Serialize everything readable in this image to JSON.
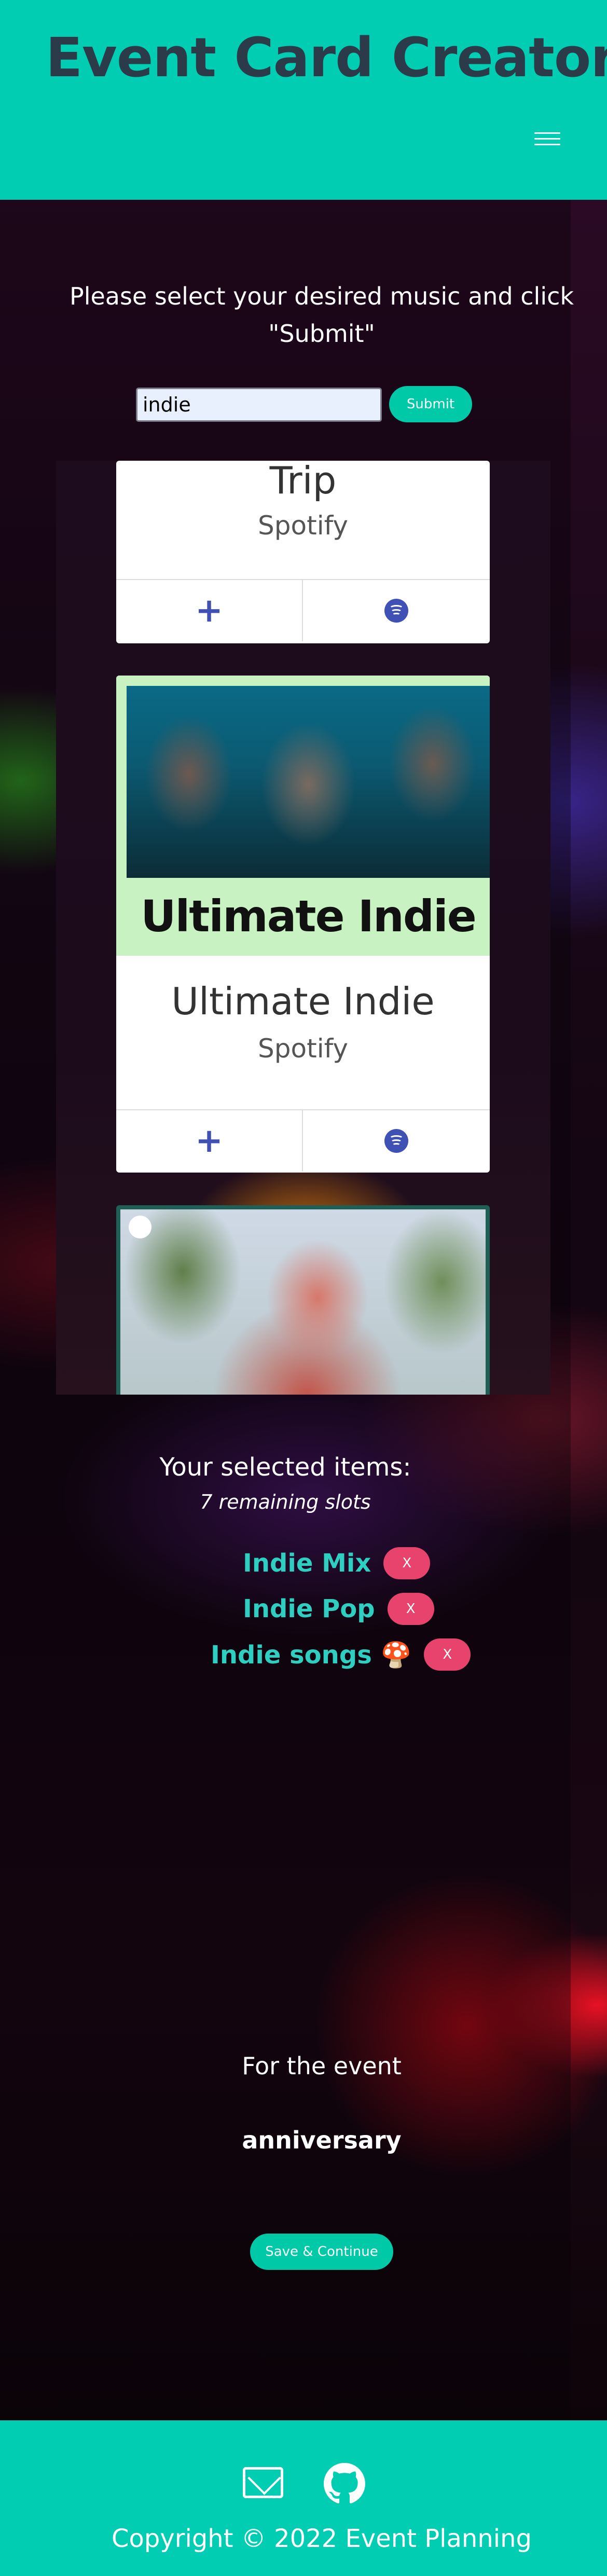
{
  "header": {
    "brand": "Event Card Creator",
    "menu_icon": "hamburger-menu-icon"
  },
  "search": {
    "prompt": "Please select your desired music and click \"Submit\"",
    "value": "indie",
    "submit_label": "Submit"
  },
  "results": [
    {
      "title": "Trip",
      "source": "Spotify"
    },
    {
      "title": "Ultimate Indie",
      "source": "Spotify",
      "cover_text": "Ultimate Indie"
    },
    {
      "title": "",
      "source": ""
    }
  ],
  "selected": {
    "title": "Your selected items:",
    "remaining": "7 remaining slots",
    "remove_label": "X",
    "items": [
      {
        "name": "Indie Mix"
      },
      {
        "name": "Indie Pop"
      },
      {
        "name": "Indie songs 🍄"
      }
    ]
  },
  "event": {
    "label": "For the event",
    "name": "anniversary",
    "save_label": "Save & Continue"
  },
  "footer": {
    "copyright": "Copyright © 2022 Event Planning",
    "icons": [
      "mail-icon",
      "github-icon"
    ]
  },
  "colors": {
    "accent": "#00cdb1",
    "remove": "#e8436c",
    "selected_text": "#2ecfc0",
    "card_action": "#3f51b5"
  }
}
